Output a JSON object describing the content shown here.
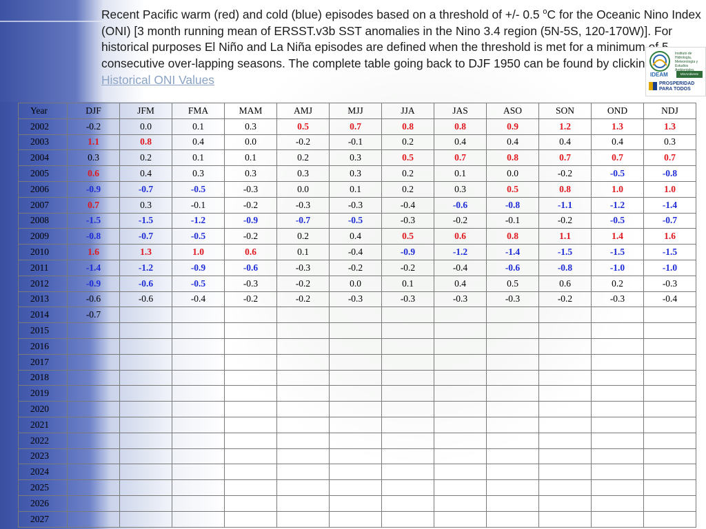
{
  "caption": {
    "part1": "Recent Pacific warm (red) and cold (blue) episodes based on a threshold of +/- 0.5 ",
    "sup": "o",
    "part2": "C for the Oceanic Nino Index (ONI) [3 month running mean of ERSST.v3b SST anomalies in the Nino 3.4 region (5N-5S, 120-170W)]. For historical purposes El Niño and La Niña episodes are defined when the threshold is met for a minimum of 5 consecutive over-lapping seasons.  The complete table going back to DJF 1950 can be found by clicking: ",
    "link": "Historical ONI Values"
  },
  "logos": {
    "ideam_name": "IDEAM",
    "ideam_text": "Instituto de Hidrología, Meteorología y Estudios Ambientales",
    "ministry": "MinAmbiente",
    "pp_line1": "PROSPERIDAD",
    "pp_line2": "PARA TODOS"
  },
  "colors": {
    "warm": "#e1171e",
    "cold": "#1e2cd8",
    "neutral": "#000000"
  },
  "table": {
    "headers": [
      "Year",
      "DJF",
      "JFM",
      "FMA",
      "MAM",
      "AMJ",
      "MJJ",
      "JJA",
      "JAS",
      "ASO",
      "SON",
      "OND",
      "NDJ"
    ],
    "rows": [
      {
        "year": "2002",
        "values": [
          "-0.2",
          "0.0",
          "0.1",
          "0.3",
          "0.5",
          "0.7",
          "0.8",
          "0.8",
          "0.9",
          "1.2",
          "1.3",
          "1.3"
        ],
        "types": [
          "n",
          "n",
          "n",
          "n",
          "w",
          "w",
          "w",
          "w",
          "w",
          "w",
          "w",
          "w"
        ]
      },
      {
        "year": "2003",
        "values": [
          "1.1",
          "0.8",
          "0.4",
          "0.0",
          "-0.2",
          "-0.1",
          "0.2",
          "0.4",
          "0.4",
          "0.4",
          "0.4",
          "0.3"
        ],
        "types": [
          "w",
          "w",
          "n",
          "n",
          "n",
          "n",
          "n",
          "n",
          "n",
          "n",
          "n",
          "n"
        ]
      },
      {
        "year": "2004",
        "values": [
          "0.3",
          "0.2",
          "0.1",
          "0.1",
          "0.2",
          "0.3",
          "0.5",
          "0.7",
          "0.8",
          "0.7",
          "0.7",
          "0.7"
        ],
        "types": [
          "n",
          "n",
          "n",
          "n",
          "n",
          "n",
          "w",
          "w",
          "w",
          "w",
          "w",
          "w"
        ]
      },
      {
        "year": "2005",
        "values": [
          "0.6",
          "0.4",
          "0.3",
          "0.3",
          "0.3",
          "0.3",
          "0.2",
          "0.1",
          "0.0",
          "-0.2",
          "-0.5",
          "-0.8"
        ],
        "types": [
          "w",
          "n",
          "n",
          "n",
          "n",
          "n",
          "n",
          "n",
          "n",
          "n",
          "c",
          "c"
        ]
      },
      {
        "year": "2006",
        "values": [
          "-0.9",
          "-0.7",
          "-0.5",
          "-0.3",
          "0.0",
          "0.1",
          "0.2",
          "0.3",
          "0.5",
          "0.8",
          "1.0",
          "1.0"
        ],
        "types": [
          "c",
          "c",
          "c",
          "n",
          "n",
          "n",
          "n",
          "n",
          "w",
          "w",
          "w",
          "w"
        ]
      },
      {
        "year": "2007",
        "values": [
          "0.7",
          "0.3",
          "-0.1",
          "-0.2",
          "-0.3",
          "-0.3",
          "-0.4",
          "-0.6",
          "-0.8",
          "-1.1",
          "-1.2",
          "-1.4"
        ],
        "types": [
          "w",
          "n",
          "n",
          "n",
          "n",
          "n",
          "n",
          "c",
          "c",
          "c",
          "c",
          "c"
        ]
      },
      {
        "year": "2008",
        "values": [
          "-1.5",
          "-1.5",
          "-1.2",
          "-0.9",
          "-0.7",
          "-0.5",
          "-0.3",
          "-0.2",
          "-0.1",
          "-0.2",
          "-0.5",
          "-0.7"
        ],
        "types": [
          "c",
          "c",
          "c",
          "c",
          "c",
          "c",
          "n",
          "n",
          "n",
          "n",
          "c",
          "c"
        ]
      },
      {
        "year": "2009",
        "values": [
          "-0.8",
          "-0.7",
          "-0.5",
          "-0.2",
          "0.2",
          "0.4",
          "0.5",
          "0.6",
          "0.8",
          "1.1",
          "1.4",
          "1.6"
        ],
        "types": [
          "c",
          "c",
          "c",
          "n",
          "n",
          "n",
          "w",
          "w",
          "w",
          "w",
          "w",
          "w"
        ]
      },
      {
        "year": "2010",
        "values": [
          "1.6",
          "1.3",
          "1.0",
          "0.6",
          "0.1",
          "-0.4",
          "-0.9",
          "-1.2",
          "-1.4",
          "-1.5",
          "-1.5",
          "-1.5"
        ],
        "types": [
          "w",
          "w",
          "w",
          "w",
          "n",
          "n",
          "c",
          "c",
          "c",
          "c",
          "c",
          "c"
        ]
      },
      {
        "year": "2011",
        "values": [
          "-1.4",
          "-1.2",
          "-0.9",
          "-0.6",
          "-0.3",
          "-0.2",
          "-0.2",
          "-0.4",
          "-0.6",
          "-0.8",
          "-1.0",
          "-1.0"
        ],
        "types": [
          "c",
          "c",
          "c",
          "c",
          "n",
          "n",
          "n",
          "n",
          "c",
          "c",
          "c",
          "c"
        ]
      },
      {
        "year": "2012",
        "values": [
          "-0.9",
          "-0.6",
          "-0.5",
          "-0.3",
          "-0.2",
          "0.0",
          "0.1",
          "0.4",
          "0.5",
          "0.6",
          "0.2",
          "-0.3"
        ],
        "types": [
          "c",
          "c",
          "c",
          "n",
          "n",
          "n",
          "n",
          "n",
          "n",
          "n",
          "n",
          "n"
        ]
      },
      {
        "year": "2013",
        "values": [
          "-0.6",
          "-0.6",
          "-0.4",
          "-0.2",
          "-0.2",
          "-0.3",
          "-0.3",
          "-0.3",
          "-0.3",
          "-0.2",
          "-0.3",
          "-0.4"
        ],
        "types": [
          "n",
          "n",
          "n",
          "n",
          "n",
          "n",
          "n",
          "n",
          "n",
          "n",
          "n",
          "n"
        ]
      },
      {
        "year": "2014",
        "values": [
          "-0.7",
          "",
          "",
          "",
          "",
          "",
          "",
          "",
          "",
          "",
          "",
          ""
        ],
        "types": [
          "n",
          "n",
          "n",
          "n",
          "n",
          "n",
          "n",
          "n",
          "n",
          "n",
          "n",
          "n"
        ]
      },
      {
        "year": "2015",
        "values": [],
        "types": []
      },
      {
        "year": "2016",
        "values": [],
        "types": []
      },
      {
        "year": "2017",
        "values": [],
        "types": []
      },
      {
        "year": "2018",
        "values": [],
        "types": []
      },
      {
        "year": "2019",
        "values": [],
        "types": []
      },
      {
        "year": "2020",
        "values": [],
        "types": []
      },
      {
        "year": "2021",
        "values": [],
        "types": []
      },
      {
        "year": "2022",
        "values": [],
        "types": []
      },
      {
        "year": "2023",
        "values": [],
        "types": []
      },
      {
        "year": "2024",
        "values": [],
        "types": []
      },
      {
        "year": "2025",
        "values": [],
        "types": []
      },
      {
        "year": "2026",
        "values": [],
        "types": []
      },
      {
        "year": "2027",
        "values": [],
        "types": []
      }
    ]
  }
}
